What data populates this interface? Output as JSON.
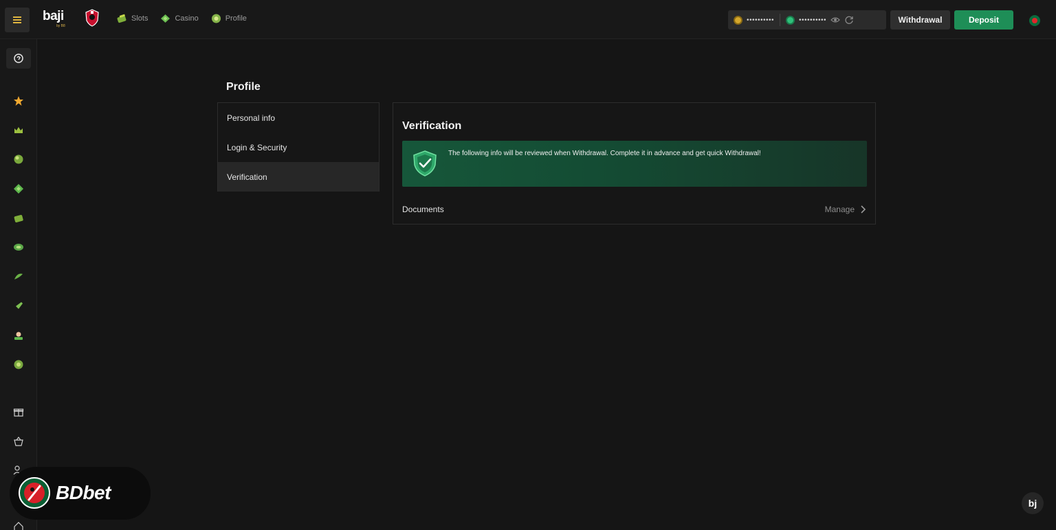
{
  "app": {
    "logo_text": "baji",
    "logo_sub": "by B8"
  },
  "nav": {
    "items": [
      {
        "label": "Slots",
        "icon": "slots-icon"
      },
      {
        "label": "Casino",
        "icon": "casino-icon"
      },
      {
        "label": "Profile",
        "icon": "profile-icon"
      }
    ]
  },
  "header": {
    "balance_main": "••••••••••",
    "balance_bonus": "••••••••••",
    "withdrawal_label": "Withdrawal",
    "deposit_label": "Deposit"
  },
  "page": {
    "title": "Profile"
  },
  "profile_menu": {
    "items": [
      {
        "label": "Personal info",
        "active": false
      },
      {
        "label": "Login & Security",
        "active": false
      },
      {
        "label": "Verification",
        "active": true
      }
    ]
  },
  "verification": {
    "title": "Verification",
    "notice": "The following info will be reviewed when Withdrawal. Complete it in advance and get quick Withdrawal!",
    "documents_label": "Documents",
    "manage_label": "Manage"
  },
  "watermark": {
    "text": "BDbet",
    "badge": "bj"
  },
  "colors": {
    "accent_green": "#1e8e57",
    "accent_gold": "#e0b640",
    "background": "#151515"
  }
}
